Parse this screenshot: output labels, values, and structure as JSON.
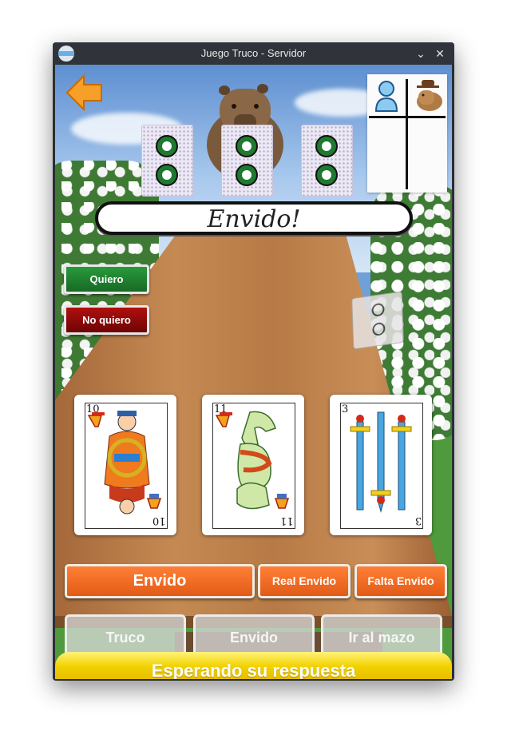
{
  "window": {
    "title": "Juego Truco - Servidor",
    "minimize_glyph": "⌄",
    "close_glyph": "✕"
  },
  "game": {
    "back_icon": "arrow-left-icon",
    "score_card": {
      "player_icon": "person-icon",
      "opponent_icon": "capybara-icon"
    },
    "opponent_cards": 3,
    "speech": "Envido!",
    "responses": {
      "quiero": "Quiero",
      "no_quiero": "No quiero"
    },
    "hand": [
      {
        "number": "10",
        "suit": "copas",
        "figure": "sota"
      },
      {
        "number": "11",
        "suit": "copas",
        "figure": "caballo"
      },
      {
        "number": "3",
        "suit": "espadas",
        "figure": "tres"
      }
    ],
    "envido_options": {
      "envido": "Envido",
      "real_envido": "Real Envido",
      "falta_envido": "Falta Envido"
    },
    "actions": {
      "truco": "Truco",
      "envido": "Envido",
      "mazo": "Ir al mazo"
    },
    "status": "Esperando su respuesta",
    "colors": {
      "quiero": "#1f8a31",
      "no_quiero": "#9c0b0b",
      "orange": "#f26b21",
      "status": "#f2d200",
      "table": "#b77a46"
    }
  }
}
